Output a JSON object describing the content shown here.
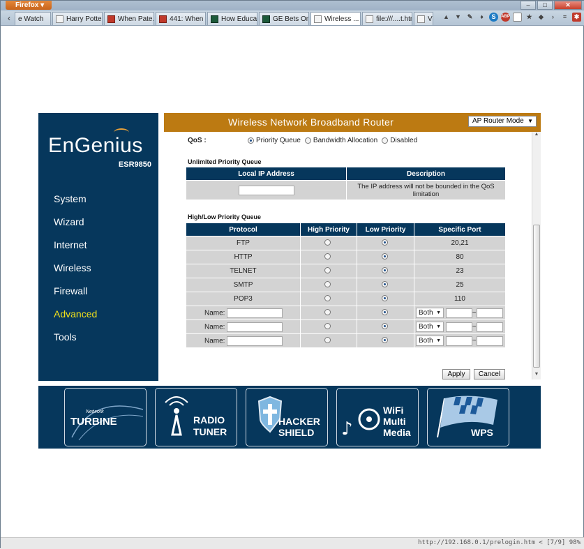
{
  "browser": {
    "app_button": "Firefox",
    "window_buttons": [
      "–",
      "□",
      "✕"
    ],
    "tabs": [
      {
        "label": "e Watch",
        "active": false
      },
      {
        "label": "Harry Potte...",
        "active": false
      },
      {
        "label": "When Pate...",
        "active": false
      },
      {
        "label": "441: When ...",
        "active": false
      },
      {
        "label": "How Educat...",
        "active": false
      },
      {
        "label": "GE Bets On ...",
        "active": false
      },
      {
        "label": "Wireless ...",
        "active": true
      },
      {
        "label": "file:///....t.html",
        "active": false
      },
      {
        "label": "Vin",
        "active": false
      }
    ],
    "toolbar_icons": [
      "up-arrow-icon",
      "down-arrow-icon",
      "pen-icon",
      "mic-icon",
      "skype-icon",
      "stop-icon",
      "page-icon",
      "bookmark-icon",
      "shield-icon",
      "chevron-right-icon",
      "list-icon",
      "addon-icon"
    ],
    "status_url": "http://192.168.0.1/prelogin.htm < [7/9] 98%"
  },
  "router": {
    "brand": "EnGenius",
    "model": "ESR9850",
    "title": "Wireless Network Broadband Router",
    "mode_select": "AP Router Mode",
    "nav": [
      {
        "label": "System",
        "active": false
      },
      {
        "label": "Wizard",
        "active": false
      },
      {
        "label": "Internet",
        "active": false
      },
      {
        "label": "Wireless",
        "active": false
      },
      {
        "label": "Firewall",
        "active": false
      },
      {
        "label": "Advanced",
        "active": true
      },
      {
        "label": "Tools",
        "active": false
      }
    ],
    "qos": {
      "label": "QoS :",
      "options": [
        {
          "label": "Priority Queue",
          "selected": true
        },
        {
          "label": "Bandwidth Allocation",
          "selected": false
        },
        {
          "label": "Disabled",
          "selected": false
        }
      ]
    },
    "unlimited": {
      "title": "Unlimited Priority Queue",
      "headers": [
        "Local IP Address",
        "Description"
      ],
      "ip_value": "",
      "description": "The IP address will not be bounded in the QoS limitation"
    },
    "highlow": {
      "title": "High/Low Priority Queue",
      "headers": [
        "Protocol",
        "High Priority",
        "Low Priority",
        "Specific Port"
      ],
      "rows": [
        {
          "protocol": "FTP",
          "priority": "low",
          "port": "20,21"
        },
        {
          "protocol": "HTTP",
          "priority": "low",
          "port": "80"
        },
        {
          "protocol": "TELNET",
          "priority": "low",
          "port": "23"
        },
        {
          "protocol": "SMTP",
          "priority": "low",
          "port": "25"
        },
        {
          "protocol": "POP3",
          "priority": "low",
          "port": "110"
        }
      ],
      "custom_rows": [
        {
          "name_label": "Name:",
          "name_value": "",
          "priority": "low",
          "proto": "Both",
          "port_from": "",
          "separator": "~",
          "port_to": ""
        },
        {
          "name_label": "Name:",
          "name_value": "",
          "priority": "low",
          "proto": "Both",
          "port_from": "",
          "separator": "~",
          "port_to": ""
        },
        {
          "name_label": "Name:",
          "name_value": "",
          "priority": "low",
          "proto": "Both",
          "port_from": "",
          "separator": "~",
          "port_to": ""
        }
      ]
    },
    "buttons": {
      "apply": "Apply",
      "cancel": "Cancel"
    },
    "banner": [
      {
        "small": "Network",
        "line1": "TURBINE",
        "line2": ""
      },
      {
        "small": "",
        "line1": "RADIO",
        "line2": "TUNER"
      },
      {
        "small": "",
        "line1": "HACKER",
        "line2": "SHIELD"
      },
      {
        "small": "",
        "line1": "WiFi",
        "line2": "Multi",
        "line3": "Media"
      },
      {
        "small": "",
        "line1": "WPS",
        "line2": ""
      }
    ]
  },
  "colors": {
    "navy": "#06375c",
    "header_orange": "#bc7a12",
    "active_nav": "#f2e21b",
    "cell_gray": "#d3d3d3"
  }
}
